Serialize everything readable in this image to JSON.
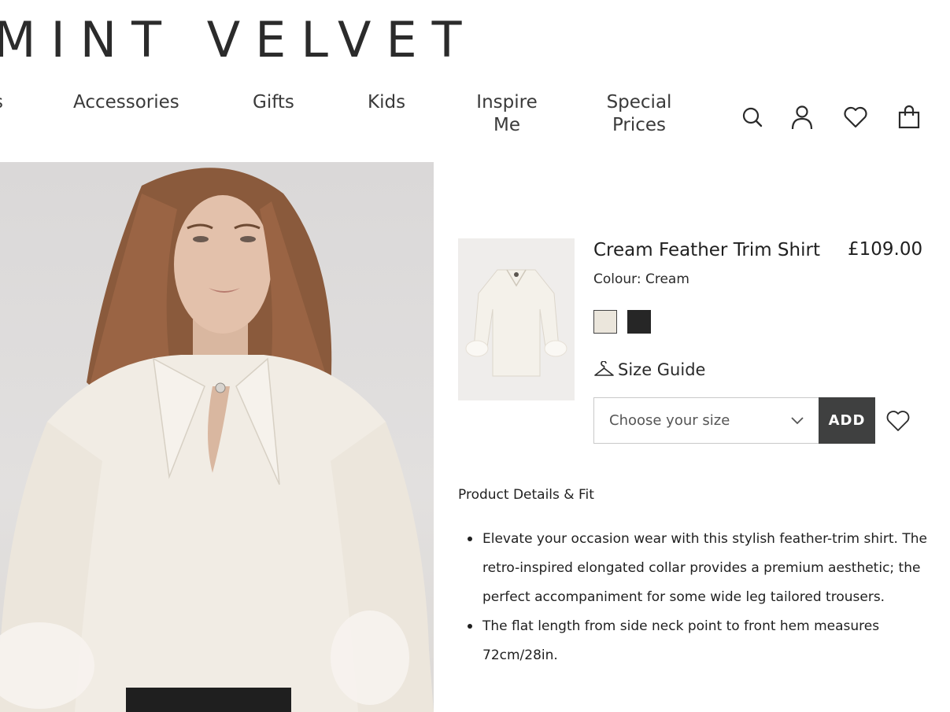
{
  "brand": {
    "logo_text": "MINT VELVET"
  },
  "nav": {
    "items": [
      {
        "label": "s"
      },
      {
        "label": "Accessories"
      },
      {
        "label": "Gifts"
      },
      {
        "label": "Kids"
      },
      {
        "label": "Inspire Me",
        "lines": [
          "Inspire",
          "Me"
        ]
      },
      {
        "label": "Special Prices",
        "lines": [
          "Special",
          "Prices"
        ]
      }
    ],
    "icons": [
      "search-icon",
      "account-icon",
      "wishlist-icon",
      "bag-icon"
    ]
  },
  "product": {
    "title": "Cream Feather Trim Shirt",
    "price": "£109.00",
    "colour_label": "Colour: Cream",
    "swatches": [
      {
        "name": "Cream",
        "color": "#ebe6dc",
        "selected": true
      },
      {
        "name": "Black",
        "color": "#262626",
        "selected": false
      }
    ],
    "size_guide_label": "Size Guide",
    "size_placeholder": "Choose your size",
    "add_label": "ADD",
    "details_heading": "Product Details & Fit",
    "details": [
      "Elevate your occasion wear with this stylish feather-trim shirt. The retro-inspired elongated collar provides a premium aesthetic; the perfect accompaniment for some wide leg tailored trousers.",
      "The flat length from side neck point to front hem measures 72cm/28in."
    ]
  },
  "colors": {
    "accent_dark": "#3f4040",
    "text": "#1f1f1f"
  }
}
